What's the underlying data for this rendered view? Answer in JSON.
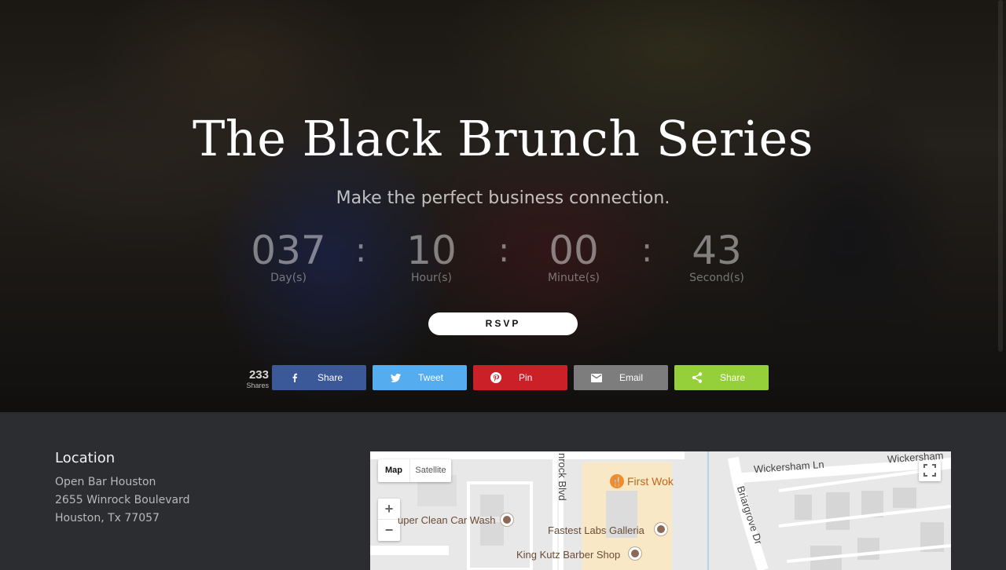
{
  "hero": {
    "title": "The Black Brunch Series",
    "subtitle": "Make the perfect business connection."
  },
  "countdown": {
    "separator": ":",
    "units": [
      {
        "value": "037",
        "label": "Day(s)"
      },
      {
        "value": "10",
        "label": "Hour(s)"
      },
      {
        "value": "00",
        "label": "Minute(s)"
      },
      {
        "value": "43",
        "label": "Second(s)"
      }
    ]
  },
  "rsvp": {
    "label": "RSVP"
  },
  "share": {
    "count": "233",
    "count_label": "Shares",
    "buttons": [
      {
        "network": "facebook",
        "label": "Share",
        "icon": "facebook-icon",
        "color": "#3b5998"
      },
      {
        "network": "twitter",
        "label": "Tweet",
        "icon": "twitter-icon",
        "color": "#55acee"
      },
      {
        "network": "pinterest",
        "label": "Pin",
        "icon": "pinterest-icon",
        "color": "#cb2027"
      },
      {
        "network": "email",
        "label": "Email",
        "icon": "email-icon",
        "color": "#7d7d7d"
      },
      {
        "network": "sharethis",
        "label": "Share",
        "icon": "share-icon",
        "color": "#95d03a"
      }
    ]
  },
  "location": {
    "heading": "Location",
    "lines": [
      "Open Bar Houston",
      "2655 Winrock Boulevard",
      "Houston, Tx 77057"
    ]
  },
  "map": {
    "type_map": "Map",
    "type_satellite": "Satellite",
    "zoom_in": "+",
    "zoom_out": "−",
    "labels": {
      "wickersham_ln": "Wickersham Ln",
      "wickersham_right": "Wickersham",
      "winrock_blvd": "nrock Blvd",
      "briargrove_dr": "Briargrove Dr",
      "first_wok": "First Wok",
      "car_wash": "uper Clean Car Wash",
      "fastest_labs": "Fastest Labs Galleria",
      "king_kutz": "King Kutz Barber Shop"
    }
  }
}
